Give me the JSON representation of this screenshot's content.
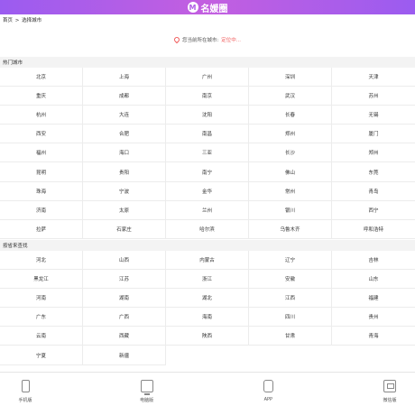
{
  "header": {
    "logo_letter": "M",
    "logo_text": "名媛圈"
  },
  "breadcrumb": {
    "home": "首页",
    "separator": ">",
    "current": "选择城市"
  },
  "location": {
    "prefix": "您当前所在城市:",
    "status": "定位中..."
  },
  "hot_cities": {
    "title": "热门城市",
    "items": [
      "北京",
      "上海",
      "广州",
      "深圳",
      "天津",
      "重庆",
      "成都",
      "南京",
      "武汉",
      "苏州",
      "杭州",
      "大连",
      "沈阳",
      "长春",
      "无锡",
      "西安",
      "合肥",
      "南昌",
      "郑州",
      "厦门",
      "福州",
      "海口",
      "三亚",
      "长沙",
      "郑州",
      "昆明",
      "贵阳",
      "南宁",
      "佛山",
      "东莞",
      "珠海",
      "宁波",
      "金华",
      "常州",
      "青岛",
      "济南",
      "太原",
      "兰州",
      "银川",
      "西宁",
      "拉萨",
      "石家庄",
      "哈尔滨",
      "乌鲁木齐",
      "呼和浩特"
    ]
  },
  "provinces": {
    "title": "按省来查找",
    "items": [
      "河北",
      "山西",
      "内蒙古",
      "辽宁",
      "吉林",
      "黑龙江",
      "江苏",
      "浙江",
      "安徽",
      "山东",
      "河南",
      "湖南",
      "湖北",
      "江西",
      "福建",
      "广东",
      "广西",
      "海南",
      "四川",
      "贵州",
      "云南",
      "西藏",
      "陕西",
      "甘肃",
      "青海",
      "宁夏",
      "新疆"
    ]
  },
  "footer": {
    "items": [
      {
        "label": "手机版",
        "icon": "phone-icon"
      },
      {
        "label": "电脑版",
        "icon": "computer-icon"
      },
      {
        "label": "APP",
        "icon": "app-icon"
      },
      {
        "label": "微信版",
        "icon": "wechat-icon"
      }
    ]
  }
}
